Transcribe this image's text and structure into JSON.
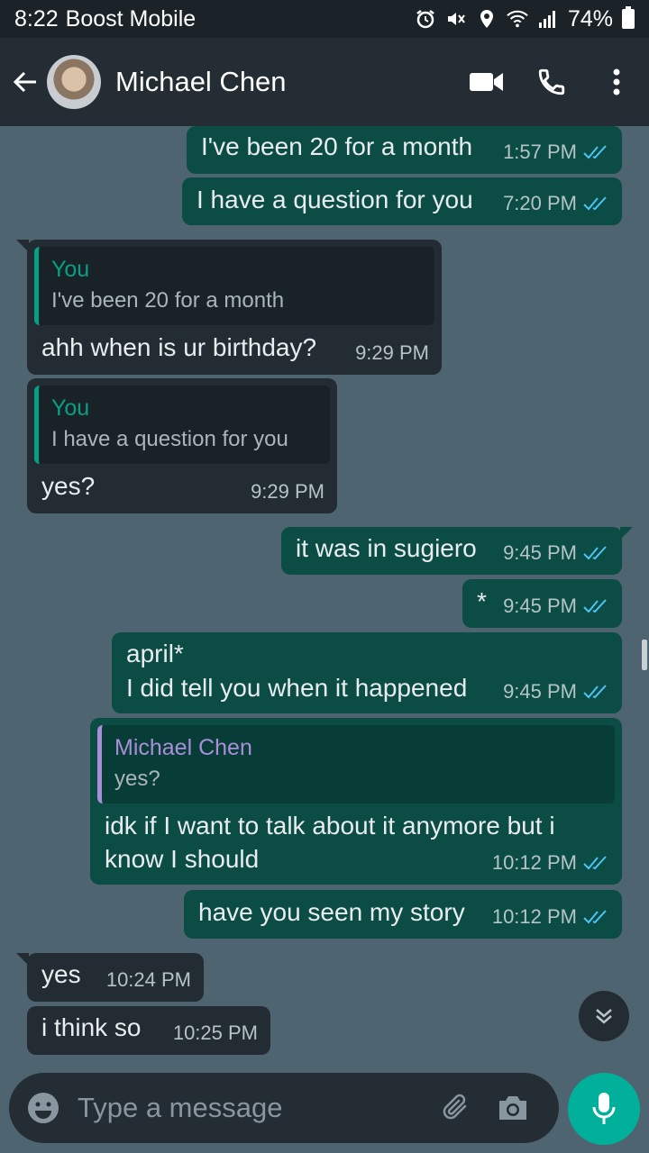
{
  "status_bar": {
    "time": "8:22",
    "carrier": "Boost Mobile",
    "battery": "74%",
    "icons": [
      "alarm-icon",
      "mute-icon",
      "location-icon",
      "wifi-icon",
      "signal-icon",
      "battery-icon"
    ]
  },
  "header": {
    "contact_name": "Michael Chen",
    "icons": [
      "back-arrow-icon",
      "avatar",
      "video-call-icon",
      "phone-icon",
      "more-options-icon"
    ]
  },
  "messages": [
    {
      "dir": "out",
      "text": "I've been 20 for a month",
      "time": "1:57 PM",
      "read": true
    },
    {
      "dir": "out",
      "text": "I have a question for you",
      "time": "7:20 PM",
      "read": true
    },
    {
      "dir": "in",
      "quote_author": "You",
      "quote_text": "I've been 20 for a month",
      "text": "ahh when is ur birthday?",
      "time": "9:29 PM"
    },
    {
      "dir": "in",
      "quote_author": "You",
      "quote_text": "I have a question for you",
      "text": "yes?",
      "time": "9:29 PM"
    },
    {
      "dir": "out",
      "text": "it was in sugiero",
      "time": "9:45 PM",
      "read": true
    },
    {
      "dir": "out",
      "text": "*",
      "time": "9:45 PM",
      "read": true
    },
    {
      "dir": "out",
      "line1": "april*",
      "line2": "I did tell you when it happened",
      "time": "9:45 PM",
      "read": true
    },
    {
      "dir": "out",
      "quote_author": "Michael Chen",
      "quote_text": "yes?",
      "line1": "idk if I want to talk about it anymore but i",
      "line2": "know I should",
      "time": "10:12 PM",
      "read": true
    },
    {
      "dir": "out",
      "text": "have you seen my story",
      "time": "10:12 PM",
      "read": true
    },
    {
      "dir": "in",
      "text": "yes",
      "time": "10:24 PM"
    },
    {
      "dir": "in",
      "text": "i think so",
      "time": "10:25 PM"
    }
  ],
  "composer": {
    "placeholder": "Type a message",
    "icons": [
      "emoji-icon",
      "attach-icon",
      "camera-icon",
      "mic-icon"
    ]
  },
  "colors": {
    "chat_bg": "#4e6571",
    "outgoing": "#0b4d45",
    "incoming": "#222c32",
    "accent": "#00b09b",
    "read_ticks": "#4fc3f7"
  }
}
